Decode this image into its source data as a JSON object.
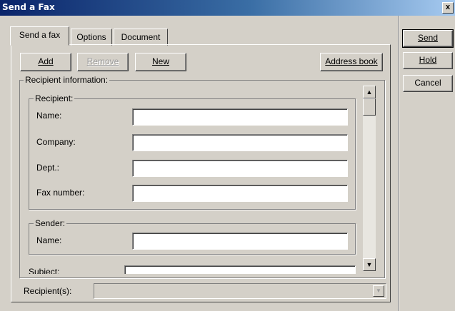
{
  "window": {
    "title": "Send a Fax",
    "close_glyph": "x"
  },
  "tabs": [
    {
      "label": "Send a fax",
      "active": true
    },
    {
      "label": "Options",
      "active": false
    },
    {
      "label": "Document",
      "active": false
    }
  ],
  "toolbar": {
    "add_label": "Add",
    "remove_label": "Remove",
    "new_label": "New",
    "address_book_label": "Address book"
  },
  "side_buttons": {
    "send_label": "Send",
    "hold_label": "Hold",
    "cancel_label": "Cancel"
  },
  "recipient_info": {
    "legend": "Recipient information:"
  },
  "recipient_group": {
    "legend": "Recipient:",
    "name_label": "Name:",
    "company_label": "Company:",
    "dept_label": "Dept.:",
    "fax_label": "Fax number:",
    "name_value": "",
    "company_value": "",
    "dept_value": "",
    "fax_value": ""
  },
  "sender_group": {
    "legend": "Sender:",
    "name_label": "Name:",
    "name_value": ""
  },
  "subject": {
    "label": "Subject:"
  },
  "recipients_combo": {
    "label": "Recipient(s):",
    "value": ""
  },
  "scrollbar": {
    "up_glyph": "▲",
    "down_glyph": "▼"
  },
  "combo_arrow": "▼"
}
